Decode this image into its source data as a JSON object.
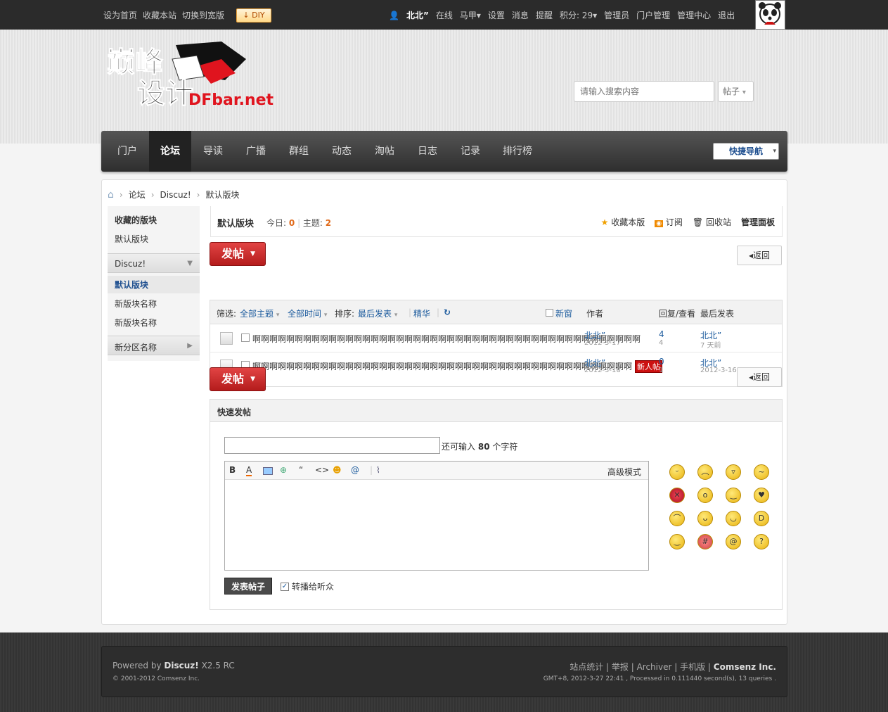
{
  "topbar": {
    "links": [
      "设为首页",
      "收藏本站",
      "切换到宽版"
    ],
    "diy": "DIY",
    "user": "北北”",
    "status": "在线",
    "vest": "马甲",
    "items": [
      "设置",
      "消息",
      "提醒"
    ],
    "credits": "积分: 29",
    "admin_links": [
      "管理员",
      "门户管理",
      "管理中心",
      "退出"
    ]
  },
  "logo": {
    "text_cn": "巅峰设计",
    "text_en": "DFbar.net"
  },
  "search": {
    "placeholder": "请输入搜索内容",
    "type": "帖子"
  },
  "nav": {
    "items": [
      "门户",
      "论坛",
      "导读",
      "广播",
      "群组",
      "动态",
      "淘帖",
      "日志",
      "记录",
      "排行榜"
    ],
    "active": "论坛",
    "quick_nav": "快捷导航"
  },
  "breadcrumb": [
    "论坛",
    "Discuz!",
    "默认版块"
  ],
  "sidebar": {
    "fav_title": "收藏的版块",
    "fav_items": [
      "默认版块"
    ],
    "group1": "Discuz!",
    "group1_items": [
      "默认版块",
      "新版块名称",
      "新版块名称"
    ],
    "group2": "新分区名称"
  },
  "forum": {
    "name": "默认版块",
    "today_label": "今日:",
    "today": "0",
    "topics_label": "主题:",
    "topics": "2",
    "actions": [
      "收藏本版",
      "订阅",
      "回收站",
      "管理面板"
    ],
    "post_label": "发帖",
    "back_label": "返回"
  },
  "filter": {
    "label": "筛选:",
    "all_topics": "全部主题",
    "all_time": "全部时间",
    "sort_label": "排序:",
    "sort": "最后发表",
    "digest": "精华",
    "new_window": "新窗",
    "col_author": "作者",
    "col_reply": "回复/查看",
    "col_last": "最后发表"
  },
  "threads": [
    {
      "title": "啊啊啊啊啊啊啊啊啊啊啊啊啊啊啊啊啊啊啊啊啊啊啊啊啊啊啊啊啊啊啊啊啊啊啊啊啊啊啊啊啊啊啊啊啊啊",
      "author": "北北”",
      "date": "2012-3-17",
      "replies": "4",
      "views": "4",
      "last_user": "北北”",
      "last_time": "7 天前",
      "new": ""
    },
    {
      "title": "啊啊啊啊啊啊啊啊啊啊啊啊啊啊啊啊啊啊啊啊啊啊啊啊啊啊啊啊啊啊啊啊啊啊啊啊啊啊啊啊啊啊啊啊啊",
      "author": "北北”",
      "date": "2012-3-16",
      "replies": "0",
      "views": "1",
      "last_user": "北北”",
      "last_time": "2012-3-16 21:14",
      "new": "新人帖"
    }
  ],
  "quick_post": {
    "title": "快速发帖",
    "hint_prefix": "还可输入",
    "hint_count": "80",
    "hint_suffix": "个字符",
    "advanced": "高级模式",
    "submit": "发表帖子",
    "relay": "转播给听众"
  },
  "footer": {
    "powered": "Powered by",
    "product": "Discuz!",
    "version": "X2.5 RC",
    "copyright": "© 2001-2012 Comsenz Inc.",
    "links": [
      "站点统计",
      "举报",
      "Archiver",
      "手机版"
    ],
    "company": "Comsenz Inc.",
    "info": "GMT+8, 2012-3-27 22:41 , Processed in 0.111440 second(s), 13 queries ."
  },
  "colors": {
    "accent": "#1d5c9e",
    "post_button": "#c62828",
    "nav_bg": "#3a3a3a"
  }
}
